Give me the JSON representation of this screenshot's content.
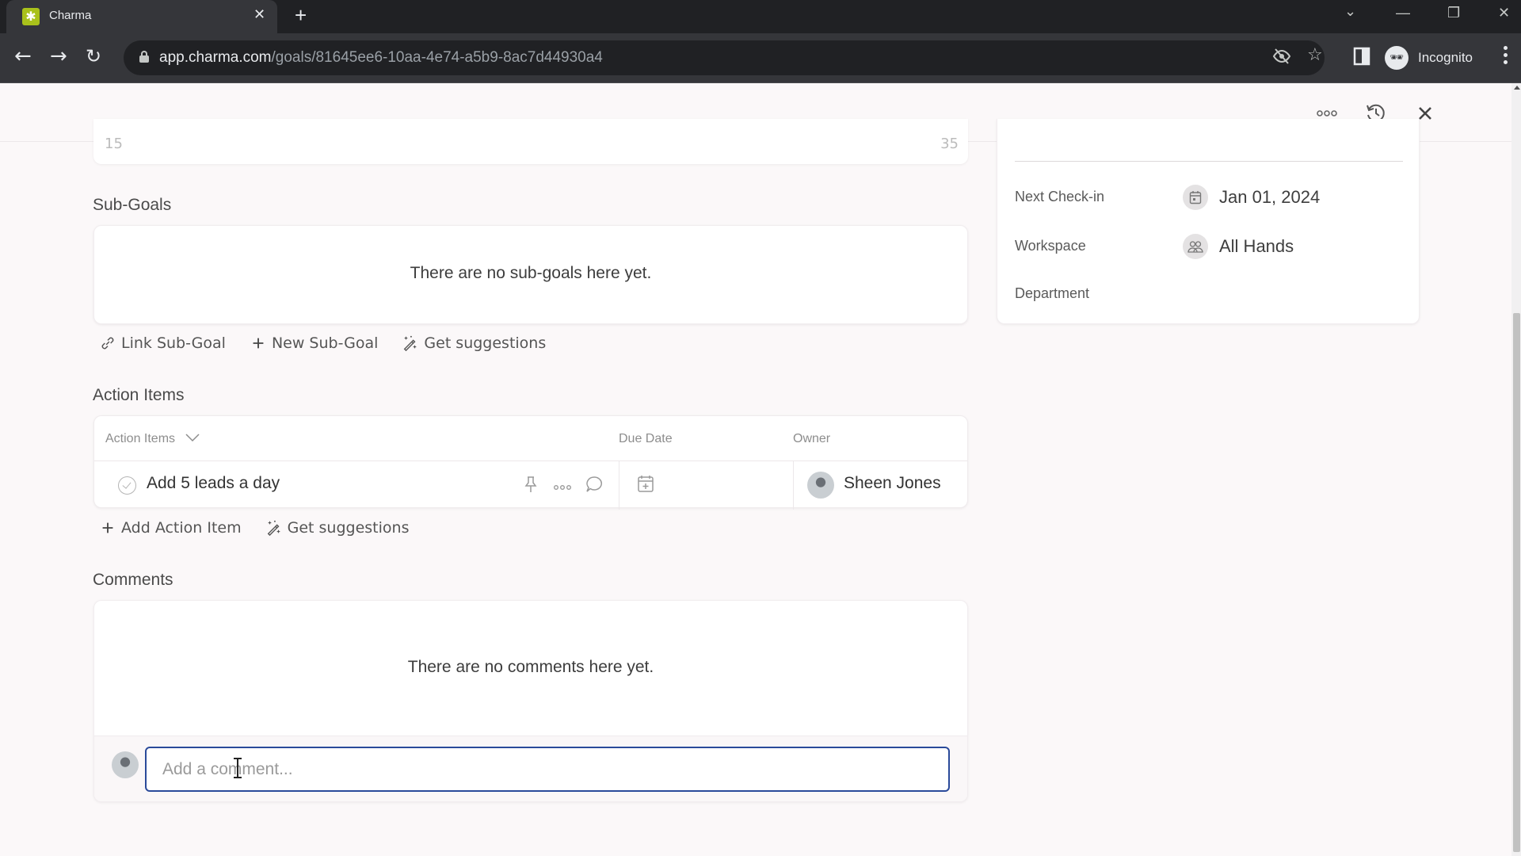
{
  "browser": {
    "tab_title": "Charma",
    "url_host": "app.charma.com",
    "url_path": "/goals/81645ee6-10aa-4e74-a5b9-8ac7d44930a4",
    "profile_label": "Incognito"
  },
  "goal_top_card": {
    "range_start": "15",
    "range_end": "35"
  },
  "subgoals": {
    "title": "Sub-Goals",
    "empty_text": "There are no sub-goals here yet.",
    "actions": [
      {
        "label": "Link Sub-Goal",
        "icon": "link-icon"
      },
      {
        "label": "New Sub-Goal",
        "icon": "plus-icon"
      },
      {
        "label": "Get suggestions",
        "icon": "magic-wand-icon"
      }
    ]
  },
  "action_items": {
    "title": "Action Items",
    "columns": [
      "Action Items",
      "Due Date",
      "Owner"
    ],
    "rows": [
      {
        "title": "Add 5 leads a day",
        "due_date": "",
        "owner": "Sheen Jones",
        "completed": false
      }
    ],
    "actions": [
      {
        "label": "Add Action Item",
        "icon": "plus-icon"
      },
      {
        "label": "Get suggestions",
        "icon": "magic-wand-icon"
      }
    ]
  },
  "comments": {
    "title": "Comments",
    "empty_text": "There are no comments here yet.",
    "input_placeholder": "Add a comment...",
    "input_value": ""
  },
  "details": {
    "fields": [
      {
        "label": "Next Check-in",
        "value": "Jan 01, 2024",
        "icon": "calendar-icon"
      },
      {
        "label": "Workspace",
        "value": "All Hands",
        "icon": "users-icon"
      },
      {
        "label": "Department",
        "value": ""
      }
    ]
  },
  "colors": {
    "brand_favicon": "#a9c11b",
    "input_focus": "#2a4a9a",
    "page_bg": "#fbf8f9"
  }
}
